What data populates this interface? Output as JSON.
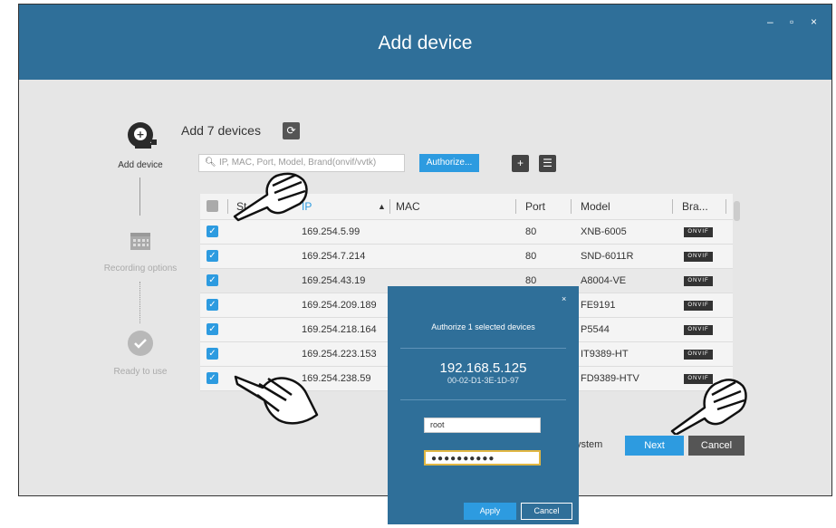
{
  "window": {
    "title": "Add device",
    "controls": {
      "minimize": "–",
      "maximize": "▫",
      "close": "×"
    }
  },
  "steps": [
    {
      "label": "Add device",
      "icon": "add-camera-icon",
      "state": "active"
    },
    {
      "label": "Recording options",
      "icon": "calendar-icon",
      "state": "inactive"
    },
    {
      "label": "Ready to use",
      "icon": "check-circle-icon",
      "state": "inactive"
    }
  ],
  "main": {
    "heading": "Add 7 devices",
    "refresh_icon": "refresh-icon",
    "search": {
      "placeholder": "IP, MAC, Port, Model, Brand(onvif/vvtk)"
    },
    "authorize_label": "Authorize...",
    "add_icon_label": "+",
    "import_icon": "list-import-icon",
    "system_fragment": "ystem",
    "next_label": "Next",
    "cancel_label": "Cancel"
  },
  "table": {
    "headers": {
      "status": "St",
      "ip": "IP",
      "sort": "▲",
      "mac": "MAC",
      "port": "Port",
      "model": "Model",
      "brand": "Bra..."
    },
    "rows": [
      {
        "ip": "169.254.5.99",
        "port": "80",
        "model": "XNB-6005",
        "brand": "ONVIF"
      },
      {
        "ip": "169.254.7.214",
        "port": "80",
        "model": "SND-6011R",
        "brand": "ONVIF"
      },
      {
        "ip": "169.254.43.19",
        "port": "80",
        "model": "A8004-VE",
        "brand": "ONVIF"
      },
      {
        "ip": "169.254.209.189",
        "port": "",
        "model": "FE9191",
        "brand": "ONVIF"
      },
      {
        "ip": "169.254.218.164",
        "port": "",
        "model": "P5544",
        "brand": "ONVIF"
      },
      {
        "ip": "169.254.223.153",
        "port": "",
        "model": "IT9389-HT",
        "brand": "ONVIF"
      },
      {
        "ip": "169.254.238.59",
        "port": "",
        "model": "FD9389-HTV",
        "brand": "ONVIF"
      }
    ]
  },
  "modal": {
    "title": "Authorize 1 selected devices",
    "ip": "192.168.5.125",
    "mac": "00-02-D1-3E-1D-97",
    "username": "root",
    "password_mask": "●●●●●●●●●●",
    "apply_label": "Apply",
    "cancel_label": "Cancel",
    "close": "×"
  },
  "colors": {
    "titlebar": "#2f6f99",
    "accent": "#2d9be0",
    "background": "#e6e6e6"
  }
}
